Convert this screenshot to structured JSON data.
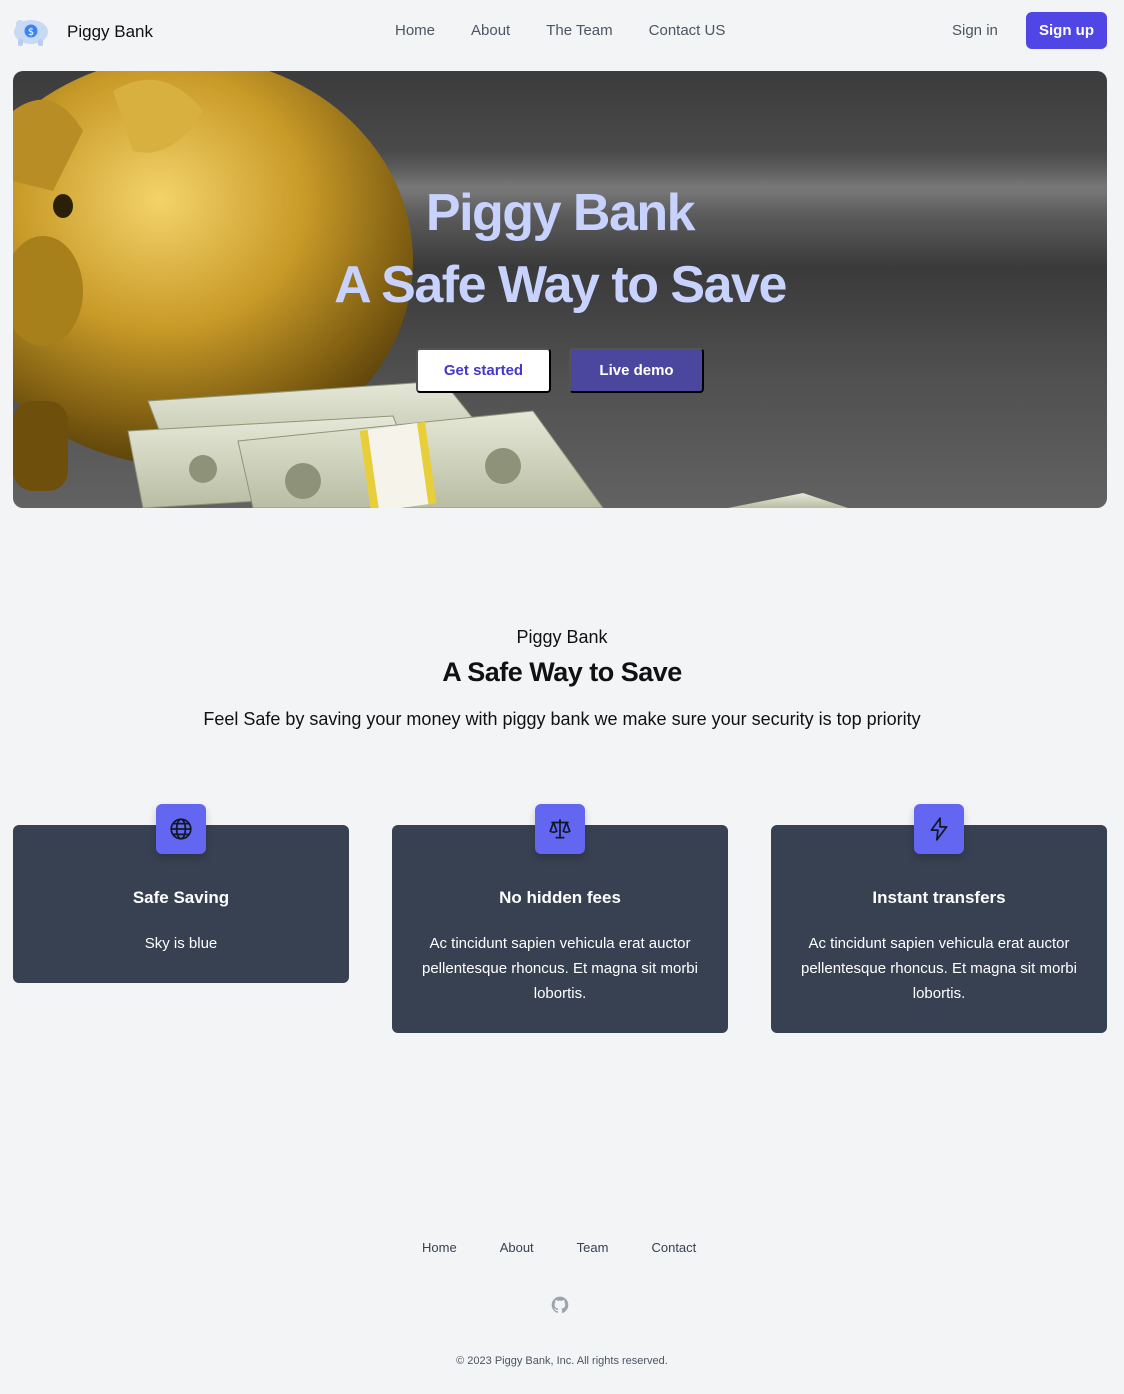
{
  "nav": {
    "brand": "Piggy Bank",
    "links": [
      "Home",
      "About",
      "The Team",
      "Contact US"
    ],
    "signin": "Sign in",
    "signup": "Sign up"
  },
  "hero": {
    "title": "Piggy Bank",
    "subtitle": "A Safe Way to Save",
    "primary_button": "Get started",
    "secondary_button": "Live demo"
  },
  "features": {
    "kicker": "Piggy Bank",
    "title": "A Safe Way to Save",
    "description": "Feel Safe by saving your money with piggy bank we make sure your security is top priority",
    "cards": [
      {
        "icon": "globe-icon",
        "title": "Safe Saving",
        "body": "Sky is blue"
      },
      {
        "icon": "scale-icon",
        "title": "No hidden fees",
        "body": "Ac tincidunt sapien vehicula erat auctor pellentesque rhoncus. Et magna sit morbi lobortis."
      },
      {
        "icon": "lightning-icon",
        "title": "Instant transfers",
        "body": "Ac tincidunt sapien vehicula erat auctor pellentesque rhoncus. Et magna sit morbi lobortis."
      }
    ]
  },
  "footer": {
    "links": [
      "Home",
      "About",
      "Team",
      "Contact"
    ],
    "copyright": "© 2023 Piggy Bank, Inc. All rights reserved."
  },
  "colors": {
    "accent": "#4f46e5",
    "icon_bg": "#6366f1",
    "card_bg": "#374151",
    "hero_text": "#c7d2fe",
    "page_bg": "#f3f4f6"
  }
}
